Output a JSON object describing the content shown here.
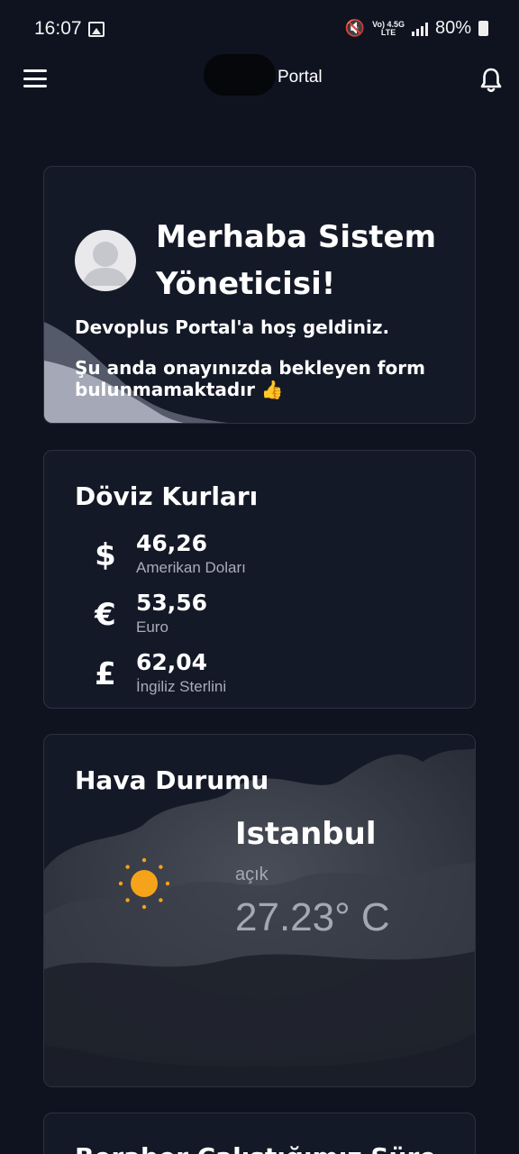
{
  "status_bar": {
    "time": "16:07",
    "net_top": "Vo) 4.5G",
    "net_bottom": "LTE",
    "battery": "80%"
  },
  "app_bar": {
    "title": "Portal"
  },
  "welcome": {
    "title": "Merhaba Sistem Yöneticisi!",
    "line1": "Devoplus Portal'a hoş geldiniz.",
    "line2": "Şu anda onayınızda bekleyen form bulunmamaktadır 👍"
  },
  "currency": {
    "title": "Döviz Kurları",
    "rates": [
      {
        "symbol": "$",
        "value": "46,26",
        "name": "Amerikan Doları"
      },
      {
        "symbol": "€",
        "value": "53,56",
        "name": "Euro"
      },
      {
        "symbol": "£",
        "value": "62,04",
        "name": "İngiliz Sterlini"
      }
    ]
  },
  "weather": {
    "title": "Hava Durumu",
    "city": "Istanbul",
    "condition": "açık",
    "temperature": "27.23° C",
    "icon": "sun-icon",
    "sun_color": "#f5a31a"
  },
  "next_card": {
    "title": "Beraber Çalıştığımız Süre"
  },
  "colors": {
    "background": "#0f1320",
    "card": "#141927",
    "card_border": "#2c3242"
  }
}
